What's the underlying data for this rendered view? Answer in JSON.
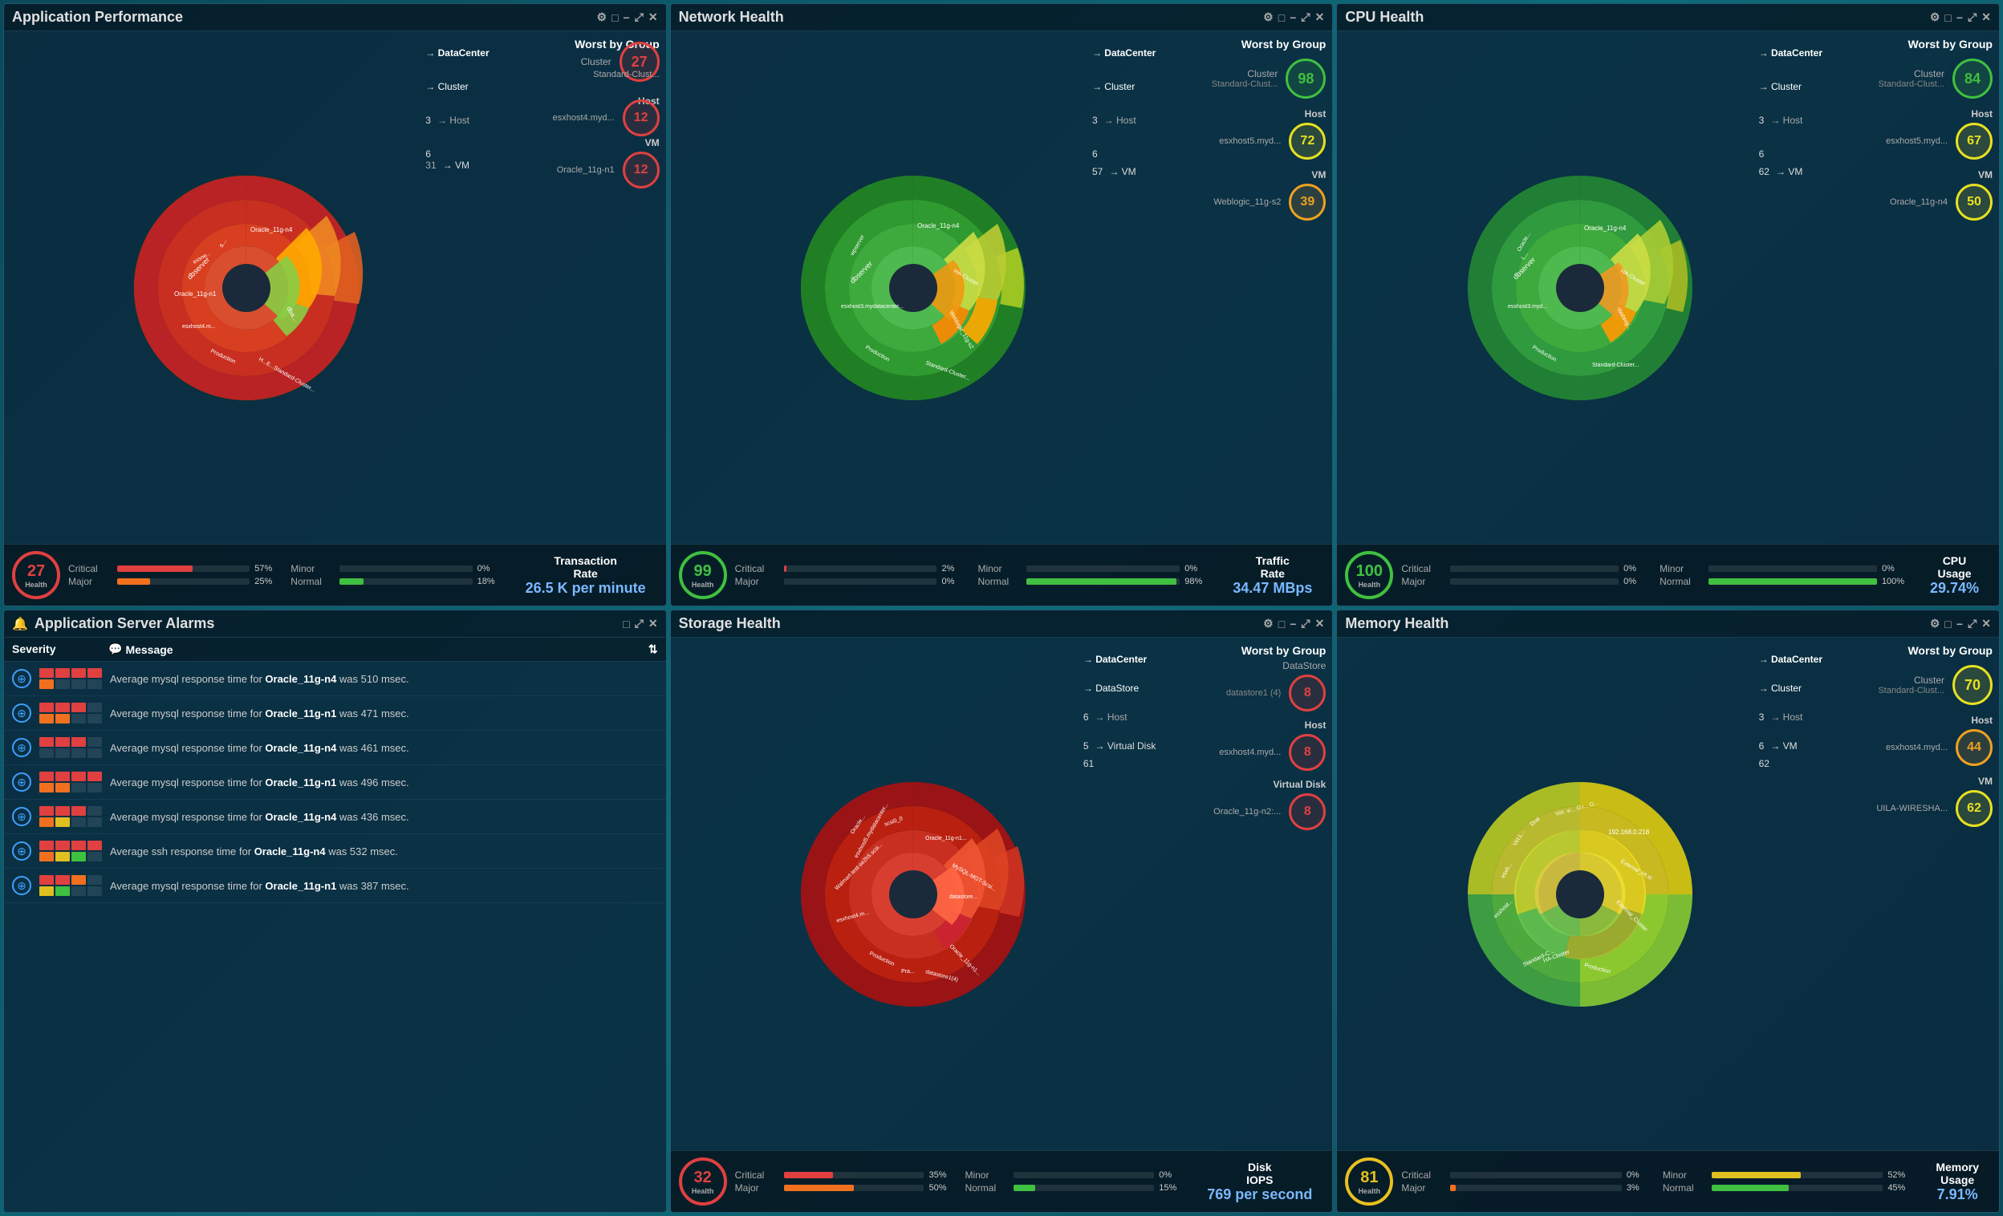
{
  "panels": {
    "app_perf": {
      "title": "Application Performance",
      "health": 27,
      "health_color": "#e04040",
      "severity": {
        "critical": {
          "label": "Critical",
          "pct": 57,
          "color": "#e04040"
        },
        "major": {
          "label": "Major",
          "pct": 25,
          "color": "#f07020"
        },
        "minor": {
          "label": "Minor",
          "pct": 0,
          "color": "#e0c020"
        },
        "normal": {
          "label": "Normal",
          "pct": 18,
          "color": "#40c040"
        }
      },
      "metric_title": "Transaction\nRate",
      "metric_value": "26.5 K per minute",
      "worst": {
        "title": "Worst by Group",
        "cluster": {
          "label": "Standard-Clust...",
          "sublabel": "Cluster",
          "value": 27,
          "color": "badge-red"
        },
        "host": {
          "label": "esxhost4.myd...",
          "sublabel": "Host",
          "value": 12,
          "color": "badge-red"
        },
        "vm": {
          "label": "Oracle_11g-n1",
          "sublabel": "VM",
          "value": 12,
          "color": "badge-red"
        }
      }
    },
    "network": {
      "title": "Network Health",
      "health": 99,
      "health_color": "#40c040",
      "severity": {
        "critical": {
          "label": "Critical",
          "pct": 2,
          "color": "#e04040"
        },
        "major": {
          "label": "Major",
          "pct": 0,
          "color": "#f07020"
        },
        "minor": {
          "label": "Minor",
          "pct": 0,
          "color": "#e0c020"
        },
        "normal": {
          "label": "Normal",
          "pct": 98,
          "color": "#40c040"
        }
      },
      "metric_title": "Traffic\nRate",
      "metric_value": "34.47 MBps",
      "worst": {
        "title": "Worst by Group",
        "cluster": {
          "label": "Standard-Clust...",
          "sublabel": "Cluster",
          "value": 98,
          "color": "badge-green"
        },
        "host": {
          "label": "esxhost5.myd...",
          "sublabel": "Host",
          "value": 72,
          "color": "badge-yellow"
        },
        "vm": {
          "label": "Weblogic_11g-s2",
          "sublabel": "VM",
          "value": 39,
          "color": "badge-orange"
        }
      }
    },
    "cpu": {
      "title": "CPU Health",
      "health": 100,
      "health_color": "#40c040",
      "severity": {
        "critical": {
          "label": "Critical",
          "pct": 0,
          "color": "#e04040"
        },
        "major": {
          "label": "Major",
          "pct": 0,
          "color": "#f07020"
        },
        "minor": {
          "label": "Minor",
          "pct": 0,
          "color": "#e0c020"
        },
        "normal": {
          "label": "Normal",
          "pct": 100,
          "color": "#40c040"
        }
      },
      "metric_title": "CPU\nUsage",
      "metric_value": "29.74%",
      "worst": {
        "title": "Worst by Group",
        "cluster": {
          "label": "Standard-Clust...",
          "sublabel": "Cluster",
          "value": 84,
          "color": "badge-green"
        },
        "host": {
          "label": "esxhost5.myd...",
          "sublabel": "Host",
          "value": 67,
          "color": "badge-yellow"
        },
        "vm": {
          "label": "Oracle_11g-n4",
          "sublabel": "VM",
          "value": 50,
          "color": "badge-yellow"
        }
      }
    },
    "alarms": {
      "title": "Application Server Alarms",
      "headers": [
        "Severity",
        "Message"
      ],
      "rows": [
        {
          "message": "Average mysql response time for <b>Oracle_11g-n4</b> was 510 msec.",
          "bars": [
            [
              "red",
              "red",
              "red",
              "red"
            ],
            [
              "orange",
              "empty",
              "empty",
              "empty"
            ]
          ]
        },
        {
          "message": "Average mysql response time for <b>Oracle_11g-n1</b> was 471 msec.",
          "bars": [
            [
              "red",
              "red",
              "red",
              "empty"
            ],
            [
              "orange",
              "orange",
              "empty",
              "empty"
            ]
          ]
        },
        {
          "message": "Average mysql response time for <b>Oracle_11g-n4</b> was 461 msec.",
          "bars": [
            [
              "red",
              "red",
              "red",
              "empty"
            ],
            [
              "empty",
              "empty",
              "empty",
              "empty"
            ]
          ]
        },
        {
          "message": "Average mysql response time for <b>Oracle_11g-n1</b> was 496 msec.",
          "bars": [
            [
              "red",
              "red",
              "red",
              "red"
            ],
            [
              "orange",
              "orange",
              "empty",
              "empty"
            ]
          ]
        },
        {
          "message": "Average mysql response time for <b>Oracle_11g-n4</b> was 436 msec.",
          "bars": [
            [
              "red",
              "red",
              "red",
              "empty"
            ],
            [
              "orange",
              "yellow",
              "empty",
              "empty"
            ]
          ]
        },
        {
          "message": "Average ssh response time for <b>Oracle_11g-n4</b> was 532 msec.",
          "bars": [
            [
              "red",
              "red",
              "red",
              "red"
            ],
            [
              "orange",
              "yellow",
              "green",
              "empty"
            ]
          ]
        },
        {
          "message": "Average mysql response time for <b>Oracle_11g-n1</b> was 387 msec.",
          "bars": [
            [
              "red",
              "red",
              "orange",
              "empty"
            ],
            [
              "yellow",
              "green",
              "empty",
              "empty"
            ]
          ]
        }
      ]
    },
    "storage": {
      "title": "Storage Health",
      "health": 32,
      "health_color": "#e04040",
      "severity": {
        "critical": {
          "label": "Critical",
          "pct": 35,
          "color": "#e04040"
        },
        "major": {
          "label": "Major",
          "pct": 50,
          "color": "#f07020"
        },
        "minor": {
          "label": "Minor",
          "pct": 0,
          "color": "#e0c020"
        },
        "normal": {
          "label": "Normal",
          "pct": 15,
          "color": "#40c040"
        }
      },
      "metric_title": "Disk\nIOPS",
      "metric_value": "769 per second",
      "worst": {
        "title": "Worst by Group",
        "datastore_label": "DataStore",
        "datastore": {
          "label": "datastore1 (4)",
          "sublabel": "DataStore",
          "value": 8,
          "color": "badge-red"
        },
        "host": {
          "label": "esxhost4.myd...",
          "sublabel": "Host",
          "value": 8,
          "color": "badge-red"
        },
        "vdisk": {
          "label": "Oracle_11g-n2:...",
          "sublabel": "Virtual Disk",
          "value": 8,
          "color": "badge-red"
        },
        "levels": [
          "DataCenter",
          "DataStore",
          "Host",
          "Virtual Disk"
        ],
        "counts": [
          6,
          5,
          61
        ]
      }
    },
    "memory": {
      "title": "Memory Health",
      "health": 81,
      "health_color": "#e8c020",
      "severity": {
        "critical": {
          "label": "Critical",
          "pct": 0,
          "color": "#e04040"
        },
        "major": {
          "label": "Major",
          "pct": 3,
          "color": "#f07020"
        },
        "minor": {
          "label": "Minor",
          "pct": 52,
          "color": "#e0c020"
        },
        "normal": {
          "label": "Normal",
          "pct": 45,
          "color": "#40c040"
        }
      },
      "metric_title": "Memory\nUsage",
      "metric_value": "7.91%",
      "worst": {
        "title": "Worst by Group",
        "cluster": {
          "label": "Standard-Clust...",
          "sublabel": "Cluster",
          "value": 70,
          "color": "badge-yellow"
        },
        "host": {
          "label": "esxhost4.myd...",
          "sublabel": "Host",
          "value": 44,
          "color": "badge-orange"
        },
        "vm": {
          "label": "UILA-WIRESHA...",
          "sublabel": "VM",
          "value": 62,
          "color": "badge-yellow"
        }
      }
    }
  },
  "controls": {
    "gear": "⚙",
    "square": "□",
    "minus": "−",
    "expand": "⤢",
    "close": "✕"
  }
}
